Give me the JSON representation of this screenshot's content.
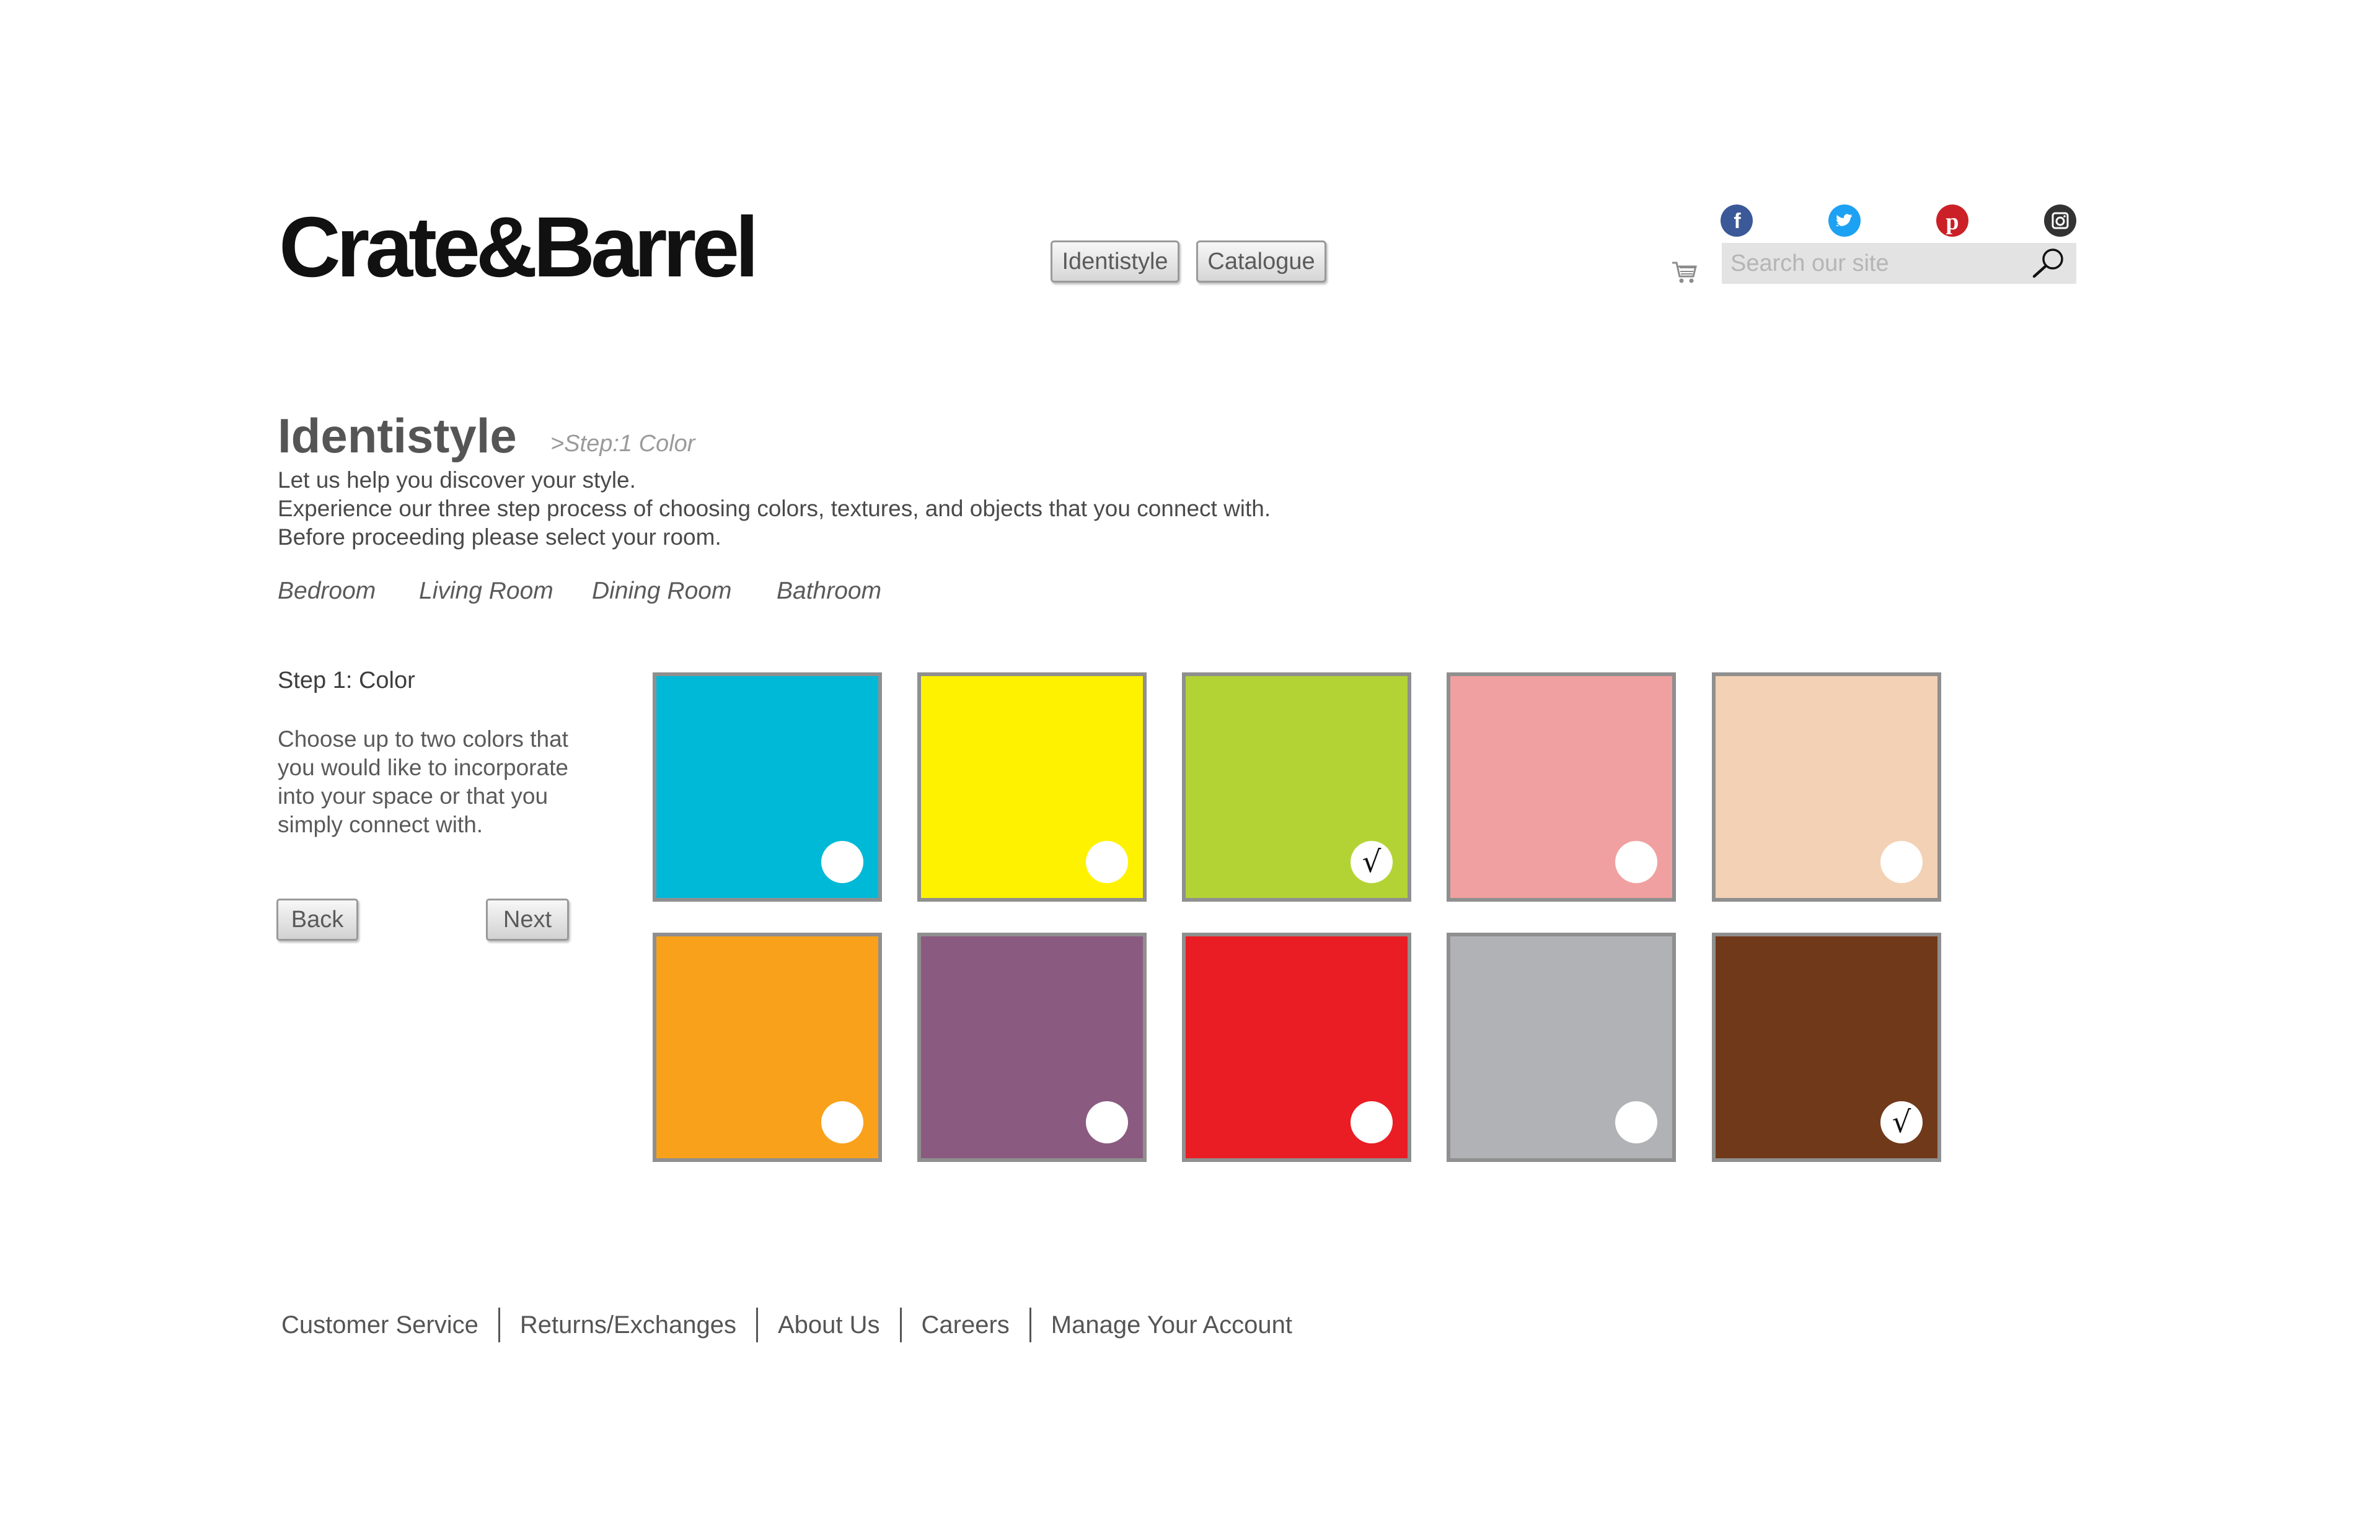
{
  "header": {
    "logo": "Crate&Barrel",
    "nav": [
      "Identistyle",
      "Catalogue"
    ],
    "social": [
      "facebook-icon",
      "twitter-icon",
      "pinterest-icon",
      "instagram-icon"
    ],
    "search": {
      "placeholder": "Search our site",
      "value": ""
    }
  },
  "intro": {
    "title": "Identistyle",
    "crumb": ">Step:1 Color",
    "lines": [
      "Let us help you discover your style.",
      "Experience our three step process of choosing colors, textures, and objects that you connect with.",
      "Before proceeding please select your room."
    ],
    "rooms": [
      "Bedroom",
      "Living Room",
      "Dining Room",
      "Bathroom"
    ]
  },
  "step": {
    "label": "Step 1: Color",
    "description_lines": [
      "Choose up to two colors that",
      "you would like to incorporate",
      "into your space or that you",
      "simply connect with."
    ],
    "back": "Back",
    "next": "Next"
  },
  "swatches": [
    {
      "color": "#00b9d6",
      "selected": false
    },
    {
      "color": "#fff200",
      "selected": false
    },
    {
      "color": "#b3d335",
      "selected": true
    },
    {
      "color": "#f0a0a0",
      "selected": false
    },
    {
      "color": "#f3d1b5",
      "selected": false
    },
    {
      "color": "#f9a11b",
      "selected": false
    },
    {
      "color": "#8a5a80",
      "selected": false
    },
    {
      "color": "#ea1c24",
      "selected": false
    },
    {
      "color": "#b1b2b5",
      "selected": false
    },
    {
      "color": "#70391a",
      "selected": true
    }
  ],
  "check_glyph": "√",
  "footer": [
    "Customer Service",
    "Returns/Exchanges",
    "About Us",
    "Careers",
    "Manage Your Account"
  ],
  "colors": {
    "facebook": "#3b5998",
    "twitter": "#1da1f2",
    "pinterest": "#cb2027",
    "instagram": "#333333"
  }
}
